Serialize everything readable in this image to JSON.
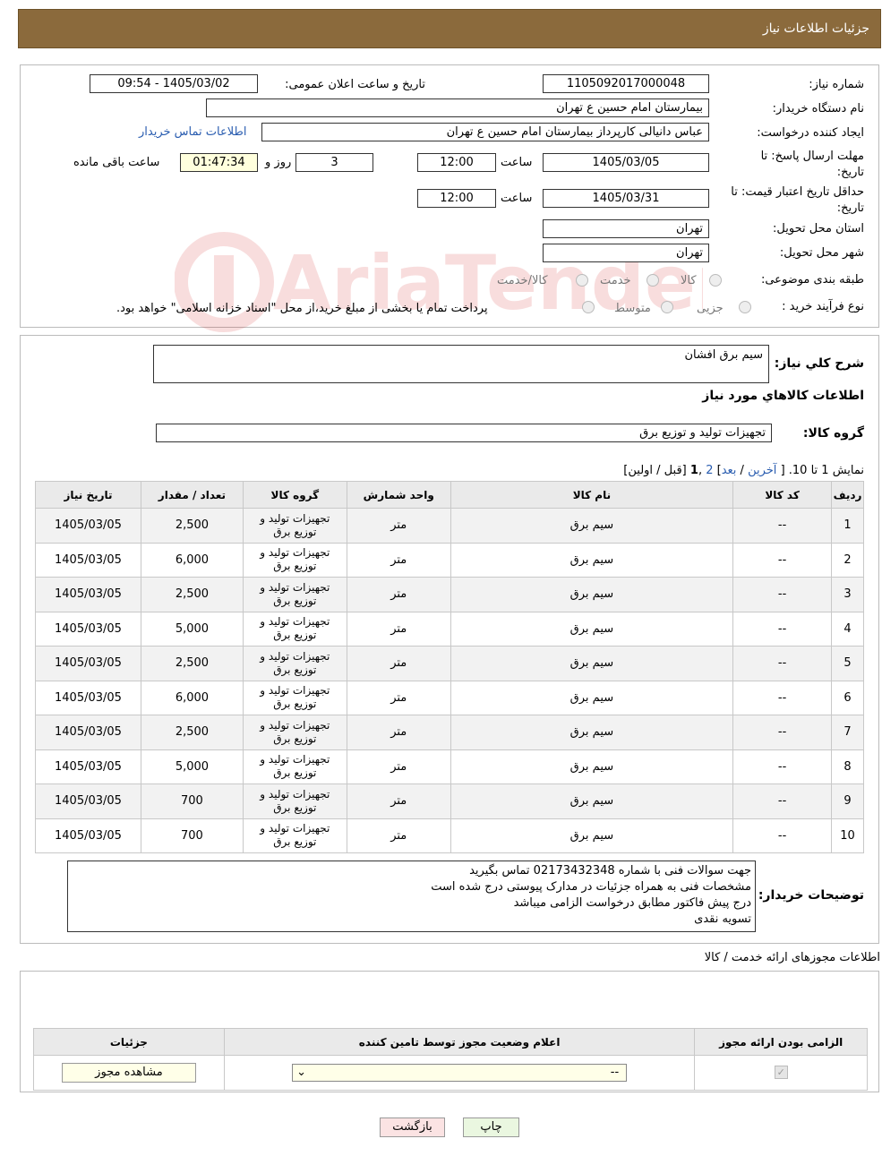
{
  "header": {
    "title": "جزئیات اطلاعات نیاز"
  },
  "info": {
    "need_number_label": "شماره نیاز:",
    "need_number": "1105092017000048",
    "announce_label": "تاریخ و ساعت اعلان عمومی:",
    "announce_value": "1405/03/02 - 09:54",
    "buyer_label": "نام دستگاه خریدار:",
    "buyer_value": "بیمارستان امام حسین  ع  تهران",
    "creator_label": "ایجاد کننده درخواست:",
    "creator_value": "عباس دانیالی کارپرداز بیمارستان امام حسین  ع  تهران",
    "contact_link": "اطلاعات تماس خریدار",
    "deadline_label": "مهلت ارسال پاسخ: تا تاریخ:",
    "deadline_date": "1405/03/05",
    "time_label": "ساعت",
    "deadline_time": "12:00",
    "days_value": "3",
    "days_label": "روز و",
    "remaining_time": "01:47:34",
    "remaining_label": "ساعت باقی مانده",
    "validity_label": "حداقل تاریخ اعتبار قیمت: تا تاریخ:",
    "validity_date": "1405/03/31",
    "validity_time": "12:00",
    "province_label": "استان محل تحویل:",
    "province_value": "تهران",
    "city_label": "شهر محل تحویل:",
    "city_value": "تهران",
    "category_label": "طبقه بندی موضوعی:",
    "category_options": [
      "کالا",
      "خدمت",
      "کالا/خدمت"
    ],
    "process_label": "نوع فرآیند خرید :",
    "process_options": [
      "جزیی",
      "متوسط"
    ],
    "process_note": "پرداخت تمام یا بخشی از مبلغ خرید،از محل \"اسناد خزانه اسلامی\" خواهد بود."
  },
  "summary": {
    "title_label": "شرح کلي نياز:",
    "title_value": "سیم برق افشان",
    "goods_info_label": "اطلاعات کالاهاي مورد نياز",
    "group_label": "گروه کالا:",
    "group_value": "تجهیزات تولید و توزیع برق"
  },
  "pagination": {
    "showing": "نمایش 1 تا 10. [",
    "last": "آخرین",
    "next": "بعد",
    "page2": "2",
    "page1": "1",
    "rest": "[قبل / اولین]"
  },
  "items_table": {
    "headers": [
      "ردیف",
      "کد کالا",
      "نام کالا",
      "واحد شمارش",
      "گروه کالا",
      "تعداد / مقدار",
      "تاریخ نیاز"
    ],
    "rows": [
      [
        "1",
        "--",
        "سیم برق",
        "متر",
        "تجهیزات تولید و توزیع برق",
        "2,500",
        "1405/03/05"
      ],
      [
        "2",
        "--",
        "سیم برق",
        "متر",
        "تجهیزات تولید و توزیع برق",
        "6,000",
        "1405/03/05"
      ],
      [
        "3",
        "--",
        "سیم برق",
        "متر",
        "تجهیزات تولید و توزیع برق",
        "2,500",
        "1405/03/05"
      ],
      [
        "4",
        "--",
        "سیم برق",
        "متر",
        "تجهیزات تولید و توزیع برق",
        "5,000",
        "1405/03/05"
      ],
      [
        "5",
        "--",
        "سیم برق",
        "متر",
        "تجهیزات تولید و توزیع برق",
        "2,500",
        "1405/03/05"
      ],
      [
        "6",
        "--",
        "سیم برق",
        "متر",
        "تجهیزات تولید و توزیع برق",
        "6,000",
        "1405/03/05"
      ],
      [
        "7",
        "--",
        "سیم برق",
        "متر",
        "تجهیزات تولید و توزیع برق",
        "2,500",
        "1405/03/05"
      ],
      [
        "8",
        "--",
        "سیم برق",
        "متر",
        "تجهیزات تولید و توزیع برق",
        "5,000",
        "1405/03/05"
      ],
      [
        "9",
        "--",
        "سیم برق",
        "متر",
        "تجهیزات تولید و توزیع برق",
        "700",
        "1405/03/05"
      ],
      [
        "10",
        "--",
        "سیم برق",
        "متر",
        "تجهیزات تولید و توزیع برق",
        "700",
        "1405/03/05"
      ]
    ]
  },
  "notes": {
    "label": "توضیحات خریدار:",
    "lines": [
      "جهت سوالات فنی با شماره 02173432348 تماس بگیرید",
      "مشخصات فنی به همراه جزئیات در مدارک پیوستی درج شده است",
      "درج پیش فاکتور مطابق درخواست الزامی میباشد",
      "تسویه نقدی"
    ]
  },
  "license": {
    "title": "اطلاعات مجوزهای ارائه خدمت / کالا",
    "headers": [
      "الزامی بودن ارائه مجوز",
      "اعلام وضعیت مجوز توسط تامین کننده",
      "جزئیات"
    ],
    "select_value": "--",
    "view_button": "مشاهده مجوز"
  },
  "buttons": {
    "print": "چاپ",
    "back": "بازگشت"
  },
  "watermark_text": "AriaTender.neT"
}
